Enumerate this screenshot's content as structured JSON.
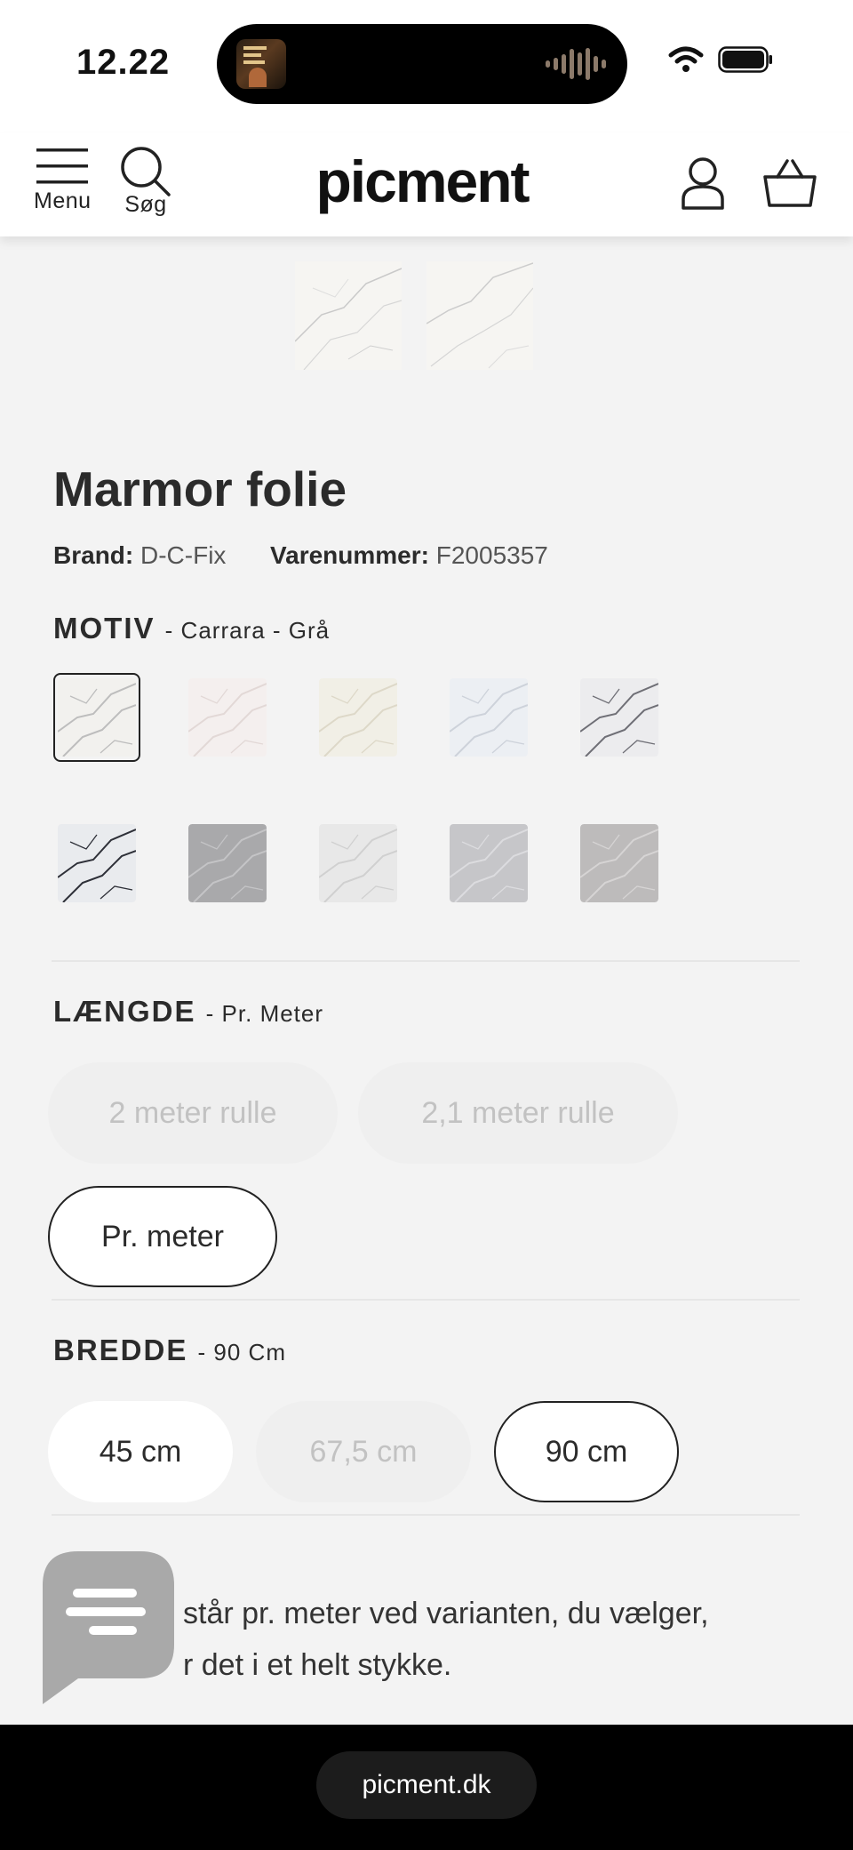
{
  "status": {
    "time": "12.22"
  },
  "header": {
    "menu_label": "Menu",
    "search_label": "Søg",
    "logo": "picment"
  },
  "product": {
    "title": "Marmor folie",
    "brand_label": "Brand:",
    "brand": "D-C-Fix",
    "sku_label": "Varenummer:",
    "sku": "F2005357"
  },
  "motiv": {
    "label": "MOTIV",
    "selected": "- Carrara - Grå",
    "swatches": [
      {
        "name": "carrara-gra",
        "base": "#f2f1ee",
        "vein": "#bdbdbd",
        "selected": true
      },
      {
        "name": "swatch-2",
        "base": "#f4efee",
        "vein": "#e2d8d6",
        "selected": false
      },
      {
        "name": "swatch-3",
        "base": "#f1efe6",
        "vein": "#ddd8c8",
        "selected": false
      },
      {
        "name": "swatch-4",
        "base": "#eceff3",
        "vein": "#cdd2da",
        "selected": false
      },
      {
        "name": "swatch-5",
        "base": "#ececee",
        "vein": "#6f6f76",
        "selected": false
      },
      {
        "name": "swatch-6",
        "base": "#e9ebee",
        "vein": "#2e3038",
        "selected": false
      },
      {
        "name": "swatch-7",
        "base": "#a9a9ab",
        "vein": "#c4c4c6",
        "selected": false
      },
      {
        "name": "swatch-8",
        "base": "#e8e8e8",
        "vein": "#d0d0d0",
        "selected": false
      },
      {
        "name": "swatch-9",
        "base": "#c6c6c9",
        "vein": "#dcdcdf",
        "selected": false
      },
      {
        "name": "swatch-10",
        "base": "#bdbbbb",
        "vein": "#d6d4d4",
        "selected": false
      }
    ]
  },
  "laengde": {
    "label": "LÆNGDE",
    "selected": "- Pr. Meter",
    "options": [
      {
        "label": "2 meter rulle",
        "state": "disabled"
      },
      {
        "label": "2,1 meter rulle",
        "state": "disabled"
      },
      {
        "label": "Pr. meter",
        "state": "selected"
      }
    ]
  },
  "bredde": {
    "label": "BREDDE",
    "selected": "- 90 Cm",
    "options": [
      {
        "label": "45 cm",
        "state": "available"
      },
      {
        "label": "67,5 cm",
        "state": "disabled"
      },
      {
        "label": "90 cm",
        "state": "selected"
      }
    ]
  },
  "description": {
    "line1": "står pr. meter ved varianten, du vælger,",
    "line2": "r det i et helt stykke."
  },
  "browser": {
    "url": "picment.dk"
  }
}
